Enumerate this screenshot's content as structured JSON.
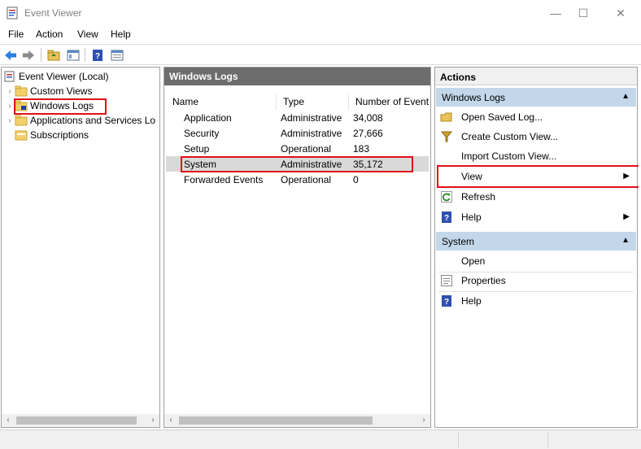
{
  "window": {
    "title": "Event Viewer",
    "controls": {
      "minimize": "—",
      "maximize": "☐",
      "close": "✕"
    }
  },
  "menubar": {
    "items": [
      "File",
      "Action",
      "View",
      "Help"
    ]
  },
  "toolbar": {
    "buttons": [
      "back-icon",
      "forward-icon",
      "up-folder-icon",
      "show-hide-tree-icon",
      "help-icon",
      "properties-icon"
    ]
  },
  "tree": {
    "items": [
      {
        "label": "Event Viewer (Local)",
        "expanded": true
      },
      {
        "label": "Custom Views",
        "expanded": false
      },
      {
        "label": "Windows Logs",
        "expanded": false,
        "selected": true
      },
      {
        "label": "Applications and Services Lo",
        "expanded": false
      },
      {
        "label": "Subscriptions"
      }
    ]
  },
  "center": {
    "header": "Windows Logs",
    "columns": [
      "Name",
      "Type",
      "Number of Events"
    ],
    "rows": [
      {
        "name": "Application",
        "type": "Administrative",
        "count": "34,008"
      },
      {
        "name": "Security",
        "type": "Administrative",
        "count": "27,666"
      },
      {
        "name": "Setup",
        "type": "Operational",
        "count": "183"
      },
      {
        "name": "System",
        "type": "Administrative",
        "count": "35,172"
      },
      {
        "name": "Forwarded Events",
        "type": "Operational",
        "count": "0"
      }
    ]
  },
  "actions": {
    "title": "Actions",
    "section1": {
      "title": "Windows Logs",
      "items": [
        "Open Saved Log...",
        "Create Custom View...",
        "Import Custom View...",
        "View",
        "Refresh",
        "Help"
      ]
    },
    "section2": {
      "title": "System",
      "items": [
        "Open",
        "Properties",
        "Help"
      ]
    }
  },
  "colors": {
    "highlight": "#e0101a",
    "section": "#c3d7ea",
    "header": "#6d6d6d"
  }
}
